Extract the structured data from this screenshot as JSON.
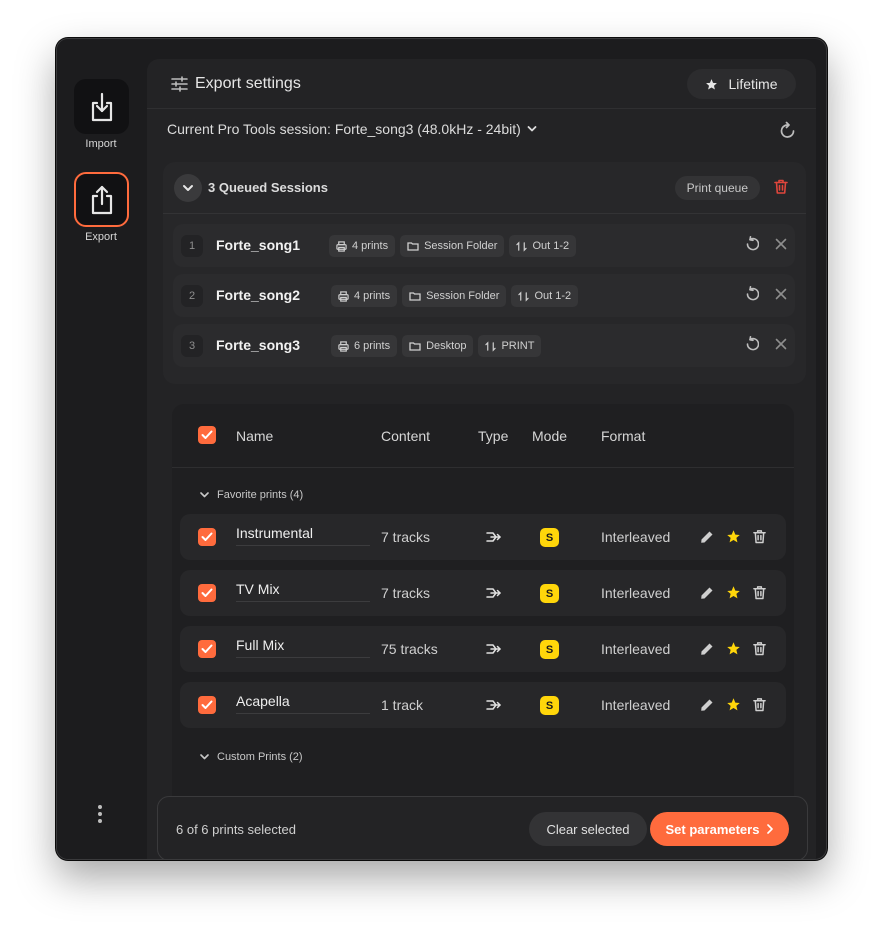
{
  "sidebar": {
    "import_label": "Import",
    "export_label": "Export"
  },
  "header": {
    "title": "Export settings",
    "lifetime_label": "Lifetime"
  },
  "session": {
    "label": "Current Pro Tools session: Forte_song3 (48.0kHz - 24bit)"
  },
  "queue": {
    "title": "3 Queued Sessions",
    "print_queue_label": "Print queue",
    "items": [
      {
        "num": "1",
        "name": "Forte_song1",
        "prints": "4 prints",
        "folder": "Session Folder",
        "output": "Out 1-2"
      },
      {
        "num": "2",
        "name": "Forte_song2",
        "prints": "4 prints",
        "folder": "Session Folder",
        "output": "Out 1-2"
      },
      {
        "num": "3",
        "name": "Forte_song3",
        "prints": "6 prints",
        "folder": "Desktop",
        "output": "PRINT"
      }
    ]
  },
  "prints": {
    "columns": {
      "name": "Name",
      "content": "Content",
      "type": "Type",
      "mode": "Mode",
      "format": "Format"
    },
    "favorite_group": "Favorite prints (4)",
    "custom_group": "Custom Prints (2)",
    "rows": [
      {
        "name": "Instrumental",
        "content": "7 tracks",
        "mode": "S",
        "format": "Interleaved"
      },
      {
        "name": "TV Mix",
        "content": "7 tracks",
        "mode": "S",
        "format": "Interleaved"
      },
      {
        "name": "Full Mix",
        "content": "75 tracks",
        "mode": "S",
        "format": "Interleaved"
      },
      {
        "name": "Acapella",
        "content": "1 track",
        "mode": "S",
        "format": "Interleaved"
      }
    ]
  },
  "footer": {
    "selection_text": "6 of 6 prints selected",
    "clear_label": "Clear selected",
    "set_label": "Set parameters"
  },
  "colors": {
    "accent": "#ff6b3d",
    "mode_badge": "#ffd60a",
    "trash_red": "#e0463c",
    "star": "#ffd60a"
  }
}
